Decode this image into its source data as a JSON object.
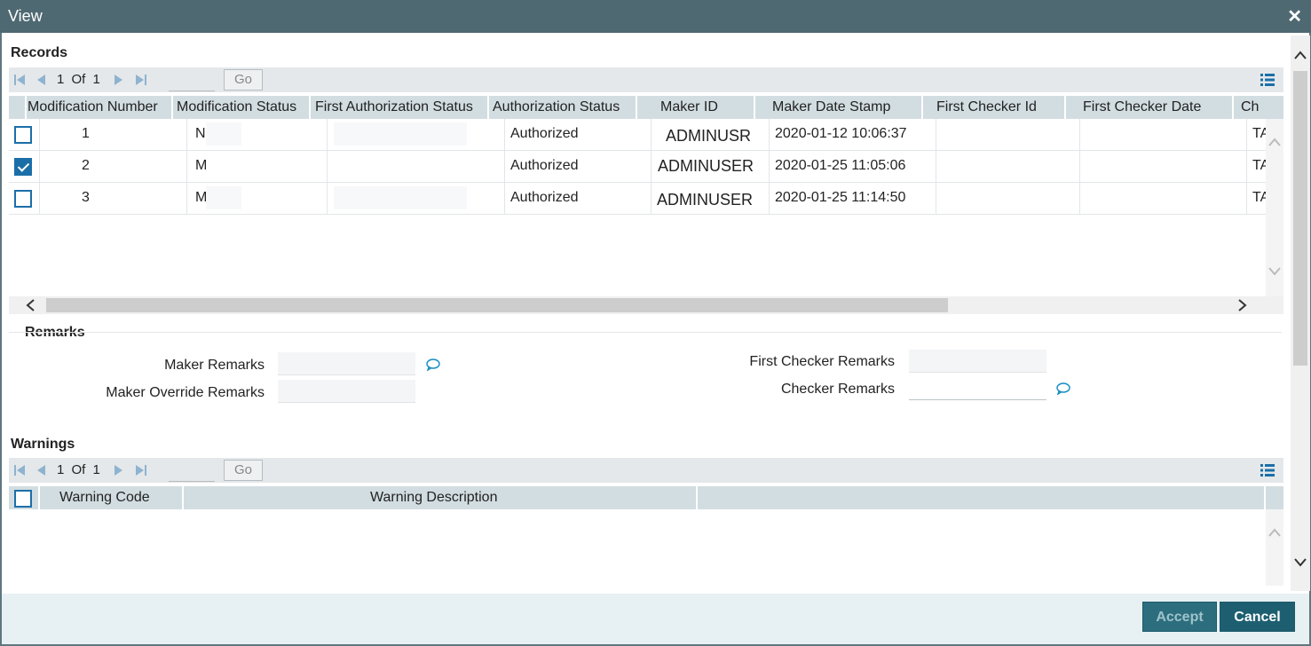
{
  "window": {
    "title": "View",
    "close_label": "✕"
  },
  "records": {
    "title": "Records",
    "pager": {
      "current": "1",
      "of_label": "Of",
      "total": "1",
      "go_label": "Go"
    },
    "columns": [
      "Modification Number",
      "Modification Status",
      "First Authorization Status",
      "Authorization Status",
      "Maker ID",
      "Maker Date Stamp",
      "First Checker Id",
      "First Checker Date",
      "Ch"
    ],
    "rows": [
      {
        "checked": false,
        "mod_number": "1",
        "mod_status": "N",
        "first_auth_status": "",
        "auth_status": "Authorized",
        "maker_id": "ADMINUSR",
        "maker_date": "2020-01-12 10:06:37",
        "first_checker_id": "",
        "first_checker_date": "",
        "ch": "TA"
      },
      {
        "checked": true,
        "mod_number": "2",
        "mod_status": "M",
        "first_auth_status": "",
        "auth_status": "Authorized",
        "maker_id": "ADMINUSER",
        "maker_date": "2020-01-25 11:05:06",
        "first_checker_id": "",
        "first_checker_date": "",
        "ch": "TA"
      },
      {
        "checked": false,
        "mod_number": "3",
        "mod_status": "M",
        "first_auth_status": "",
        "auth_status": "Authorized",
        "maker_id": "ADMINUSER",
        "maker_date": "2020-01-25 11:14:50",
        "first_checker_id": "",
        "first_checker_date": "",
        "ch": "TA"
      }
    ]
  },
  "remarks": {
    "title": "Remarks",
    "maker_remarks_label": "Maker Remarks",
    "maker_override_label": "Maker Override Remarks",
    "first_checker_label": "First Checker Remarks",
    "checker_label": "Checker Remarks",
    "maker_remarks_value": "",
    "maker_override_value": "",
    "first_checker_value": "",
    "checker_value": ""
  },
  "warnings": {
    "title": "Warnings",
    "pager": {
      "current": "1",
      "of_label": "Of",
      "total": "1",
      "go_label": "Go"
    },
    "columns": [
      "Warning Code",
      "Warning Description"
    ]
  },
  "footer": {
    "accept_label": "Accept",
    "cancel_label": "Cancel"
  },
  "colors": {
    "titlebar": "#4f6972",
    "header": "#d2dde1",
    "accent": "#1b6fa8",
    "button": "#1d5f70"
  }
}
